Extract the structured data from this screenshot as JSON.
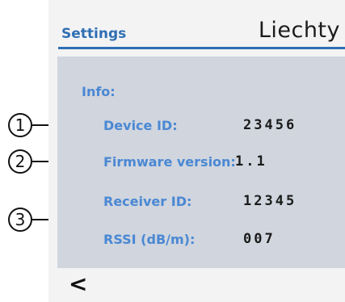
{
  "header": {
    "title": "Settings",
    "logo_text": "Liechty"
  },
  "info": {
    "title": "Info:",
    "rows": [
      {
        "label": "Device ID:",
        "value": "23456"
      },
      {
        "label": "Firmware version:",
        "value": "1.1"
      },
      {
        "label": "Receiver ID:",
        "value": "12345"
      },
      {
        "label": "RSSI (dB/m):",
        "value": "007"
      }
    ]
  },
  "nav": {
    "back_label": "<"
  },
  "callouts": [
    "1",
    "2",
    "3"
  ],
  "colors": {
    "accent": "#2f6fb3",
    "label": "#4a88d3",
    "panel": "#d0d5de",
    "background": "#f3f3f4"
  }
}
